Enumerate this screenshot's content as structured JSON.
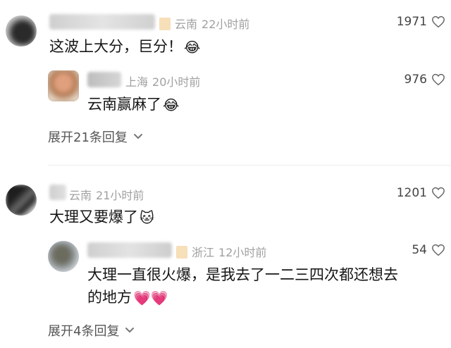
{
  "comments": [
    {
      "location": "云南",
      "time": "22小时前",
      "text": "这波上大分，巨分！",
      "emoji": "😂",
      "likes": "1971",
      "reply": {
        "name_partial": "上海",
        "time": "20小时前",
        "text": "云南赢麻了",
        "emoji": "😂",
        "likes": "976"
      },
      "expand_label": "展开21条回复"
    },
    {
      "location": "云南",
      "time": "21小时前",
      "text": "大理又要爆了",
      "emoji": "🐱",
      "likes": "1201",
      "reply": {
        "location": "浙江",
        "time": "12小时前",
        "text_line1": "大理一直很火爆，是我去了一二三四次都还想去",
        "text_line2": "的地方",
        "emoji": "💗💗",
        "likes": "54"
      },
      "expand_label": "展开4条回复"
    }
  ]
}
